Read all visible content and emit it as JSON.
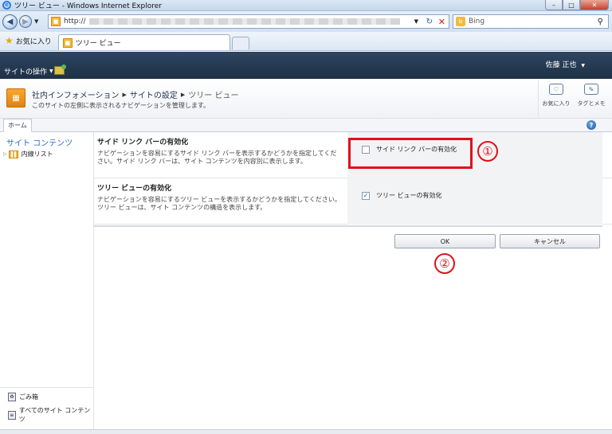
{
  "window": {
    "title": "ツリー ビュー - Windows Internet Explorer",
    "controls": {
      "minimize": "–",
      "maximize": "□",
      "close": "✕"
    }
  },
  "addressbar": {
    "url_prefix": "http://",
    "search_placeholder": "Bing"
  },
  "favorites": {
    "label": "お気に入り",
    "tab_title": "ツリー ビュー"
  },
  "sp_header": {
    "site_actions": "サイトの操作",
    "user_name": "佐藤 正也"
  },
  "title_area": {
    "breadcrumb": [
      "社内インフォメーション",
      "サイトの設定",
      "ツリー ビュー"
    ],
    "description": "このサイトの左側に表示されるナビゲーションを管理します。",
    "actions": [
      {
        "label": "お気に入り",
        "icon": "like-tag-icon"
      },
      {
        "label": "タグとメモ",
        "icon": "tag-note-icon"
      }
    ]
  },
  "ribbon": {
    "home_tab": "ホーム",
    "help": "?"
  },
  "leftnav": {
    "heading": "サイト コンテンツ",
    "items": [
      {
        "label": "内線リスト"
      }
    ],
    "bottom": [
      {
        "label": "ごみ箱"
      },
      {
        "label": "すべてのサイト コンテンツ"
      }
    ]
  },
  "settings": {
    "sidelink": {
      "title": "サイド リンク バーの有効化",
      "description": "ナビゲーションを容易にするサイド リンク バーを表示するかどうかを指定してください。サイド リンク バーは、サイト コンテンツを内容別に表示します。",
      "checkbox_label": "サイド リンク バーの有効化",
      "checked": false
    },
    "treeview": {
      "title": "ツリー ビューの有効化",
      "description": "ナビゲーションを容易にするツリー ビューを表示するかどうかを指定してください。ツリー ビューは、サイト コンテンツの構造を表示します。",
      "checkbox_label": "ツリー ビューの有効化",
      "checked": true
    }
  },
  "buttons": {
    "ok": "OK",
    "cancel": "キャンセル"
  },
  "annotations": {
    "marker_1": "①",
    "marker_2": "②"
  },
  "colors": {
    "highlight": "#e0101a",
    "ribbon_dark": "#1d3046",
    "link": "#2a6bbf"
  }
}
